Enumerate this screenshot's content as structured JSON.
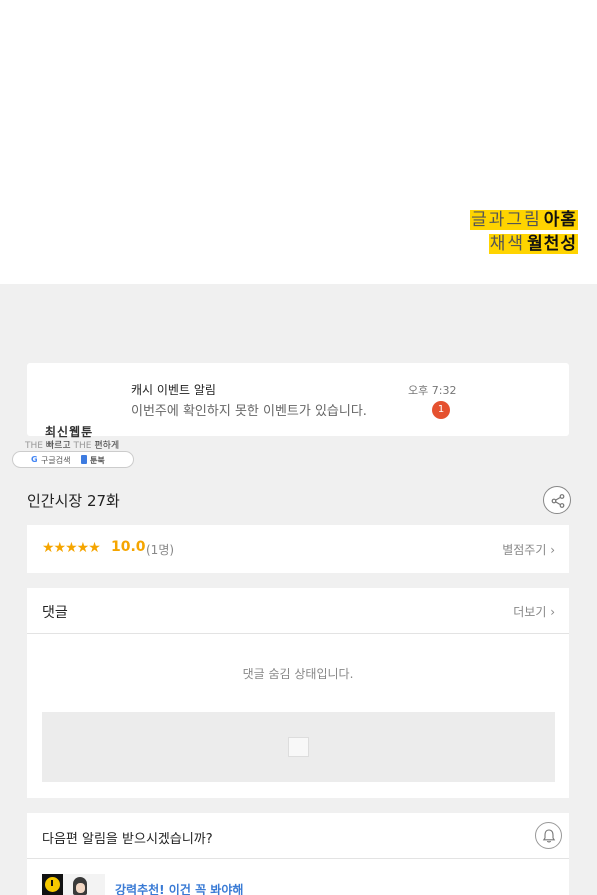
{
  "credits": {
    "writer_role": "글과그림",
    "writer_name": "아홈",
    "color_role": "채색",
    "color_name": "월천성"
  },
  "notification": {
    "title": "캐시 이벤트 알림",
    "body": "이번주에 확인하지 못한 이벤트가 있습니다.",
    "time": "오후 7:32",
    "badge": "1"
  },
  "promo": {
    "title": "최신웹툰",
    "tag_the1": "THE",
    "tag_word1": "빠르고",
    "tag_the2": "THE",
    "tag_word2": "편하게",
    "google_letter": "G",
    "google_text": "구글검색",
    "site": "툰북"
  },
  "episode": {
    "title": "인간시장 27화"
  },
  "rating": {
    "stars": "★★★★★",
    "score": "10.0",
    "count": "(1명)",
    "rate_link": "별점주기 ›"
  },
  "comments": {
    "title": "댓글",
    "more_link": "더보기 ›",
    "hidden_message": "댓글 숨김 상태입니다."
  },
  "next_alert": {
    "question": "다음편 알림을 받으시겠습니까?",
    "recommend_text": "강력추천! 이건 꼭 봐야해"
  },
  "colors": {
    "highlight": "#ffd400",
    "star": "#f5a500",
    "badge": "#e5512f",
    "link_blue": "#3a7bd5"
  }
}
